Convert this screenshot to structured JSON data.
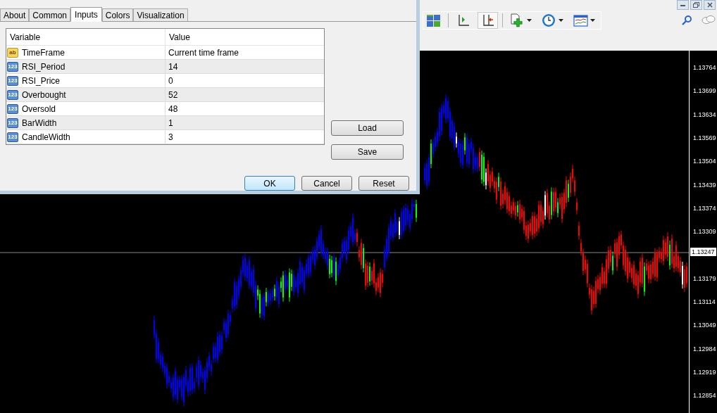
{
  "dialog": {
    "tabs": [
      {
        "label": "About",
        "selected": false
      },
      {
        "label": "Common",
        "selected": false
      },
      {
        "label": "Inputs",
        "selected": true
      },
      {
        "label": "Colors",
        "selected": false
      },
      {
        "label": "Visualization",
        "selected": false
      }
    ],
    "table": {
      "columns": [
        "Variable",
        "Value"
      ],
      "rows": [
        {
          "type_label": "ab",
          "kind": "string",
          "variable": "TimeFrame",
          "value": "Current time frame"
        },
        {
          "type_label": "123",
          "kind": "number",
          "variable": "RSI_Period",
          "value": "14"
        },
        {
          "type_label": "123",
          "kind": "number",
          "variable": "RSI_Price",
          "value": "0"
        },
        {
          "type_label": "123",
          "kind": "number",
          "variable": "Overbought",
          "value": "52"
        },
        {
          "type_label": "123",
          "kind": "number",
          "variable": "Oversold",
          "value": "48"
        },
        {
          "type_label": "123",
          "kind": "number",
          "variable": "BarWidth",
          "value": "1"
        },
        {
          "type_label": "123",
          "kind": "number",
          "variable": "CandleWidth",
          "value": "3"
        }
      ]
    },
    "side_buttons": [
      "Load",
      "Save"
    ],
    "buttons": [
      {
        "label": "OK",
        "default": true
      },
      {
        "label": "Cancel",
        "default": false
      },
      {
        "label": "Reset",
        "default": false
      }
    ]
  },
  "toolbar": {
    "items": [
      {
        "kind": "tile",
        "selected": false,
        "dropdown": false
      },
      {
        "kind": "autoscroll",
        "selected": false,
        "dropdown": false
      },
      {
        "kind": "shift",
        "selected": true,
        "dropdown": false
      },
      {
        "kind": "indicators",
        "selected": false,
        "dropdown": true
      },
      {
        "kind": "periods",
        "selected": false,
        "dropdown": true
      },
      {
        "kind": "templates",
        "selected": false,
        "dropdown": true
      }
    ]
  },
  "price_axis": {
    "labels": [
      "1.13764",
      "1.13699",
      "1.13634",
      "1.13569",
      "1.13504",
      "1.13439",
      "1.13374",
      "1.13309",
      "1.13179",
      "1.13114",
      "1.13049",
      "1.12984",
      "1.12919",
      "1.12854"
    ],
    "current_price": "1.13247"
  }
}
